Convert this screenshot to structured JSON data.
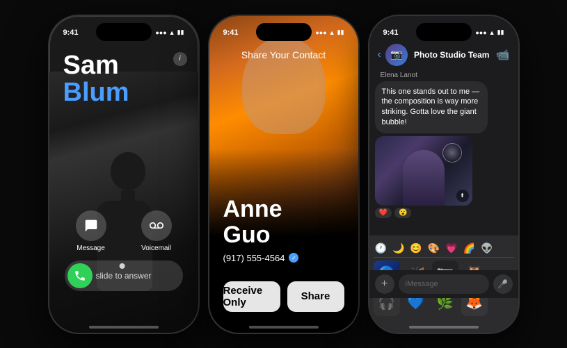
{
  "phones": {
    "phone1": {
      "status_time": "9:41",
      "caller_first": "Sam",
      "caller_last": "Blum",
      "message_btn": "Message",
      "voicemail_btn": "Voicemail",
      "slide_text": "slide to answer"
    },
    "phone2": {
      "status_time": "9:41",
      "share_title": "Share Your Contact",
      "contact_first": "Anne",
      "contact_last": "Guo",
      "contact_phone": "(917) 555-4564",
      "receive_only_btn": "Receive Only",
      "share_btn": "Share"
    },
    "phone3": {
      "status_time": "9:41",
      "group_name": "Photo Studio Team",
      "sender_name": "Elena Lanot",
      "message_text": "This one stands out to me — the composition is way more striking. Gotta love the giant bubble!",
      "input_placeholder": "iMessage",
      "emojis": [
        "🕐",
        "🌙",
        "😊",
        "🎨",
        "💗",
        "🌈",
        "👽"
      ],
      "emoji_items": [
        "🦋",
        "📷",
        "🦉",
        "🎧",
        "💙",
        "🌿",
        "🦊"
      ]
    }
  }
}
